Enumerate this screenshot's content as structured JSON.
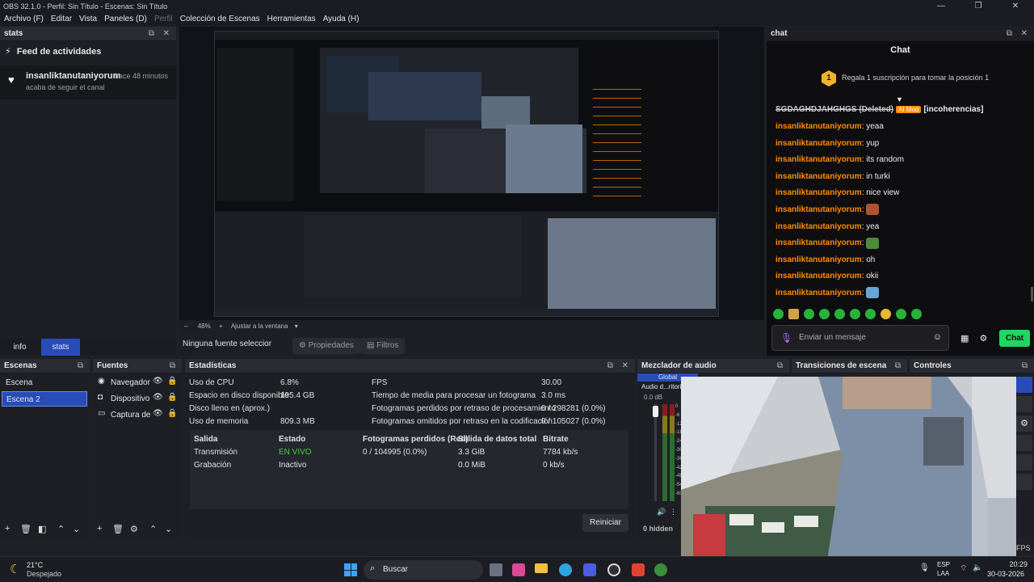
{
  "window": {
    "title": "OBS 32.1.0 - Perfil: Sin Título - Escenas: Sin Título"
  },
  "menu": [
    "Archivo (F)",
    "Editar",
    "Vista",
    "Paneles (D)",
    "Perfil",
    "Colección de Escenas",
    "Herramientas",
    "Ayuda (H)"
  ],
  "stats_dock": {
    "title": "stats",
    "feed_title": "Feed de actividades",
    "feed_user": "insanliktanutaniyorum",
    "feed_time": "hace 48 minutos",
    "feed_action": "acaba de seguir el canal"
  },
  "tabs": {
    "info": "info",
    "stats": "stats"
  },
  "preview": {
    "zoom": "48%",
    "fit": "Ajustar a la ventana"
  },
  "propbar": {
    "no_source": "Ninguna fuente seleccionada",
    "properties": "Propiedades",
    "filters": "Filtros"
  },
  "chat": {
    "dock_title": "chat",
    "title": "Chat",
    "gift_text": "Regala 1 suscripción para tomar la posición 1",
    "gift_rank": "1",
    "deleted_user": "SGDAGHDJAHGHGS (Deleted)",
    "mod_badge": "AI Mod",
    "deleted_text": "[incoherencias]",
    "messages": [
      {
        "user": "insanliktanutaniyorum",
        "text": ": yeaa"
      },
      {
        "user": "insanliktanutaniyorum",
        "text": ": yup"
      },
      {
        "user": "insanliktanutaniyorum",
        "text": ": its random"
      },
      {
        "user": "insanliktanutaniyorum",
        "text": ": in turki"
      },
      {
        "user": "insanliktanutaniyorum",
        "text": ": nice view"
      },
      {
        "user": "insanliktanutaniyorum",
        "text": ":"
      },
      {
        "user": "insanliktanutaniyorum",
        "text": ": yea"
      },
      {
        "user": "insanliktanutaniyorum",
        "text": ":"
      },
      {
        "user": "insanliktanutaniyorum",
        "text": ": oh"
      },
      {
        "user": "insanliktanutaniyorum",
        "text": ": okii"
      },
      {
        "user": "insanliktanutaniyorum",
        "text": ":"
      }
    ],
    "input_placeholder": "Enviar un mensaje",
    "send_label": "Chat"
  },
  "scenes": {
    "title": "Escenas",
    "items": [
      "Escena",
      "Escena 2"
    ]
  },
  "sources": {
    "title": "Fuentes",
    "items": [
      "Navegador",
      "Dispositivo de",
      "Captura de p"
    ]
  },
  "stats": {
    "title": "Estadísticas",
    "rows_left": [
      {
        "label": "Uso de CPU",
        "value": "6.8%"
      },
      {
        "label": "Espacio en disco disponible",
        "value": "195.4 GB"
      },
      {
        "label": "Disco lleno en (aprox.)",
        "value": ""
      },
      {
        "label": "Uso de memoria",
        "value": "809.3 MB"
      }
    ],
    "rows_right": [
      {
        "label": "FPS",
        "value": "30.00"
      },
      {
        "label": "Tiempo de media para procesar un fotograma",
        "value": "3.0 ms"
      },
      {
        "label": "Fotogramas perdidos por retraso de procesamiento",
        "value": "0 / 298281 (0.0%)"
      },
      {
        "label": "Fotogramas omitidos por retraso en la codificación",
        "value": "0 / 105027 (0.0%)"
      }
    ],
    "table_headers": [
      "Salida",
      "Estado",
      "Fotogramas perdidos (Red)",
      "Salida de datos total",
      "Bitrate"
    ],
    "table_rows": [
      [
        "Transmisión",
        "EN VIVO",
        "0 / 104995 (0.0%)",
        "3.3 GiB",
        "7784 kb/s"
      ],
      [
        "Grabación",
        "Inactivo",
        "",
        "0.0 MiB",
        "0 kb/s"
      ]
    ],
    "reset": "Reiniciar"
  },
  "mixer": {
    "title": "Mezclador de audio",
    "tab_global": "Global",
    "device": "Audio d...ritorio",
    "db": "0.0 dB",
    "hidden": "0 hidden",
    "scale": [
      "0",
      "-6",
      "-12",
      "-18",
      "-24",
      "-30",
      "-36",
      "-42",
      "-48",
      "-54",
      "-60"
    ]
  },
  "transitions": {
    "title": "Transiciones de escena"
  },
  "controls": {
    "title": "Controles"
  },
  "statusbar": {
    "fps": "FPS"
  },
  "taskbar": {
    "weather_temp": "21°C",
    "weather_desc": "Despejado",
    "search": "Buscar",
    "lang": "ESP",
    "lang2": "LAA",
    "time": "20:29",
    "date": "30-03-2026"
  }
}
